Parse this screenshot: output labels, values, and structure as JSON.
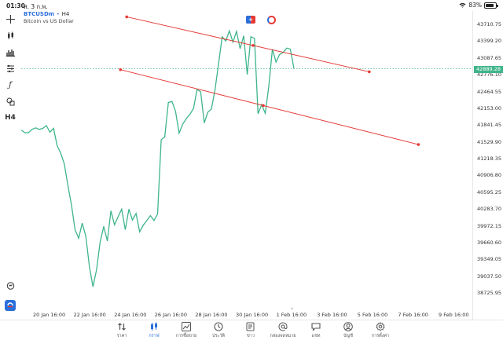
{
  "status_bar": {
    "time": "01:30",
    "date": "ส. 3 ก.พ.",
    "battery": "83%",
    "battery_level": 0.83
  },
  "chart": {
    "symbol": "BTCUSDm",
    "timeframe": "H4",
    "description": "Bitcoin vs US Dollar",
    "current_price": "42889.28",
    "colors": {
      "line": "#3fb58a",
      "trendline": "#e53935",
      "accent": "#2a6fdb"
    }
  },
  "left_toolbar": {
    "icons": [
      "crosshair-icon",
      "candlestick-icon",
      "bar-chart-icon",
      "sliders-icon",
      "function-icon",
      "shapes-icon",
      "timeframe-h4"
    ],
    "h4_label": "H4"
  },
  "chart_data": {
    "type": "line",
    "title": "",
    "series": [
      {
        "values": [
          41750,
          41700,
          41700,
          41760,
          41790,
          41760,
          41780,
          41830,
          41710,
          41780,
          41460,
          41320,
          41120,
          40720,
          40360,
          39900,
          39740,
          40020,
          39780,
          39210,
          38840,
          39160,
          39670,
          39960,
          39690,
          40250,
          39990,
          40140,
          40280,
          39900,
          40280,
          40080,
          40200,
          39860,
          39980,
          40070,
          40160,
          40070,
          40190,
          41570,
          41620,
          42260,
          42280,
          42100,
          41690,
          41860,
          41960,
          42040,
          42150,
          42500,
          42460,
          41880,
          42080,
          42140,
          42500,
          42980,
          43480,
          43400,
          43590,
          43380,
          43580,
          43260,
          43500,
          42780,
          43480,
          43450,
          42050,
          42220,
          42060,
          42560,
          43250,
          43010,
          43150,
          43190,
          43270,
          43250,
          42890
        ]
      }
    ],
    "x_tick_labels": [
      "20 Jan 16:00",
      "22 Jan 16:00",
      "24 Jan 16:00",
      "26 Jan 16:00",
      "28 Jan 16:00",
      "30 Jan 16:00",
      "1 Feb 16:00",
      "3 Feb 16:00",
      "5 Feb 16:00",
      "7 Feb 16:00",
      "9 Feb 16:00"
    ],
    "y_tick_labels": [
      "43710.75",
      "43399.20",
      "43087.65",
      "42776.10",
      "42464.55",
      "42153.00",
      "41841.45",
      "41529.90",
      "41218.35",
      "40906.80",
      "40595.25",
      "40283.70",
      "39972.15",
      "39660.60",
      "39349.05",
      "39037.50",
      "38725.95"
    ],
    "ylim": [
      38725.95,
      43710.75
    ],
    "grid": false,
    "trendlines": [
      {
        "x_start": "24 Jan 16:00",
        "y_start": 43850,
        "x_end": "5 Feb 16:00",
        "y_end": 42830
      },
      {
        "x_start": "24 Jan 16:00",
        "y_start": 42870,
        "x_end": "7 Feb 16:00",
        "y_end": 41480
      }
    ]
  },
  "tabs": [
    {
      "label": "ราคา",
      "icon": "sort-arrows-icon"
    },
    {
      "label": "กราฟ",
      "icon": "candlestick-icon",
      "active": true
    },
    {
      "label": "การซื้อขาย",
      "icon": "trend-chart-icon"
    },
    {
      "label": "ประวัติ",
      "icon": "history-icon"
    },
    {
      "label": "ข่าว",
      "icon": "news-icon"
    },
    {
      "label": "กล่องจดหมาย",
      "icon": "at-icon"
    },
    {
      "label": "แชท",
      "icon": "chat-icon"
    },
    {
      "label": "บัญชี",
      "icon": "account-icon"
    },
    {
      "label": "การตั้งค่า",
      "icon": "gear-icon"
    }
  ]
}
